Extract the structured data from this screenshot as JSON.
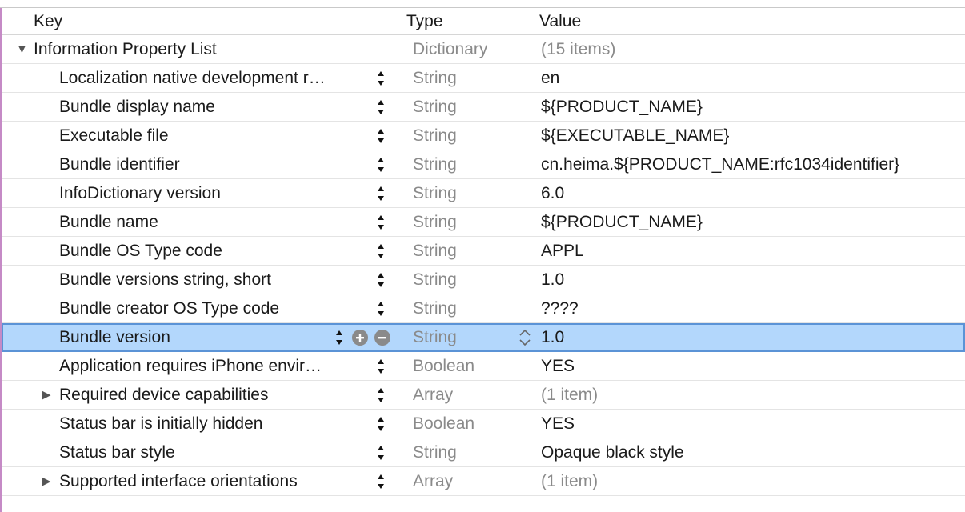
{
  "header": {
    "key": "Key",
    "type": "Type",
    "value": "Value"
  },
  "root": {
    "key": "Information Property List",
    "type": "Dictionary",
    "value": "(15 items)"
  },
  "rows": [
    {
      "key": "Localization native development r…",
      "type": "String",
      "value": "en"
    },
    {
      "key": "Bundle display name",
      "type": "String",
      "value": "${PRODUCT_NAME}"
    },
    {
      "key": "Executable file",
      "type": "String",
      "value": "${EXECUTABLE_NAME}"
    },
    {
      "key": "Bundle identifier",
      "type": "String",
      "value": "cn.heima.${PRODUCT_NAME:rfc1034identifier}"
    },
    {
      "key": "InfoDictionary version",
      "type": "String",
      "value": "6.0"
    },
    {
      "key": "Bundle name",
      "type": "String",
      "value": "${PRODUCT_NAME}"
    },
    {
      "key": "Bundle OS Type code",
      "type": "String",
      "value": "APPL"
    },
    {
      "key": "Bundle versions string, short",
      "type": "String",
      "value": "1.0"
    },
    {
      "key": "Bundle creator OS Type code",
      "type": "String",
      "value": "????"
    },
    {
      "key": "Bundle version",
      "type": "String",
      "value": "1.0"
    },
    {
      "key": "Application requires iPhone envir…",
      "type": "Boolean",
      "value": "YES"
    },
    {
      "key": "Required device capabilities",
      "type": "Array",
      "value": "(1 item)"
    },
    {
      "key": "Status bar is initially hidden",
      "type": "Boolean",
      "value": "YES"
    },
    {
      "key": "Status bar style",
      "type": "String",
      "value": "Opaque black style"
    },
    {
      "key": "Supported interface orientations",
      "type": "Array",
      "value": "(1 item)"
    }
  ],
  "colors": {
    "selection": "#b3d7fc",
    "selection_border": "#5b93d6",
    "muted": "#8a8a8a"
  },
  "icons": {
    "expanded": "triangle-down-icon",
    "collapsed": "triangle-right-icon",
    "stepper": "up-down-stepper-icon",
    "add": "plus-circle-icon",
    "remove": "minus-circle-icon",
    "type_popup": "chevron-up-down-icon"
  }
}
